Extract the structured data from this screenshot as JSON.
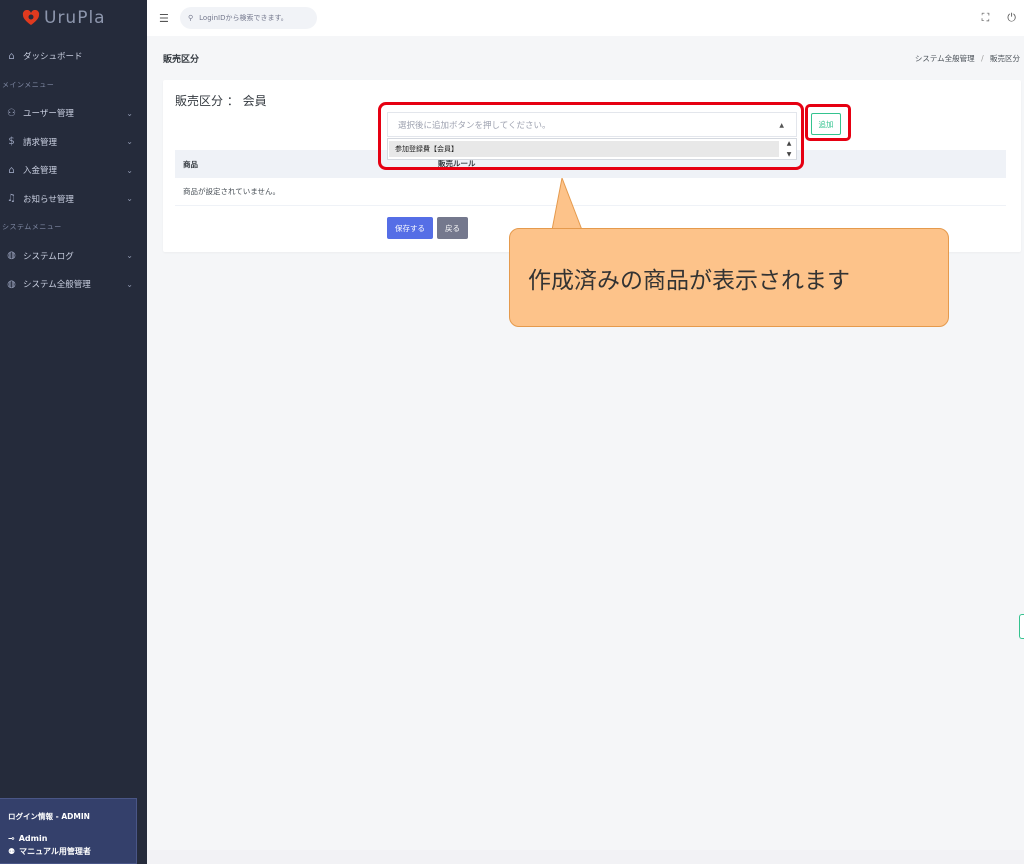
{
  "brand": {
    "name": "UruPla",
    "accent": "#e03a1f"
  },
  "topbar": {
    "search_placeholder": "LoginIDから検索できます。",
    "icons": [
      "menu-icon",
      "search-icon",
      "fullscreen-icon",
      "power-icon"
    ]
  },
  "sidebar": {
    "dashboard": "ダッシュボード",
    "main_menu_title": "メインメニュー",
    "main_items": [
      {
        "label": "ユーザー管理",
        "icon": "user-icon"
      },
      {
        "label": "請求管理",
        "icon": "dollar-icon"
      },
      {
        "label": "入金管理",
        "icon": "bank-icon"
      },
      {
        "label": "お知らせ管理",
        "icon": "bell-icon"
      }
    ],
    "system_menu_title": "システムメニュー",
    "system_items": [
      {
        "label": "システムログ",
        "icon": "globe-icon"
      },
      {
        "label": "システム全般管理",
        "icon": "globe-icon"
      }
    ],
    "login": {
      "title": "ログイン情報 - ADMIN",
      "user": "Admin",
      "role": "マニュアル用管理者"
    }
  },
  "page": {
    "title": "販売区分",
    "breadcrumb": {
      "parent": "システム全般管理",
      "sep": "/",
      "current": "販売区分"
    }
  },
  "card": {
    "title": "販売区分 ： 会員",
    "select_placeholder": "選択後に追加ボタンを押してください。",
    "listbox_option": "参加登録費【会員】",
    "add_button": "追加",
    "table": {
      "headers": [
        "商品",
        "販売ルール"
      ],
      "empty_message": "商品が設定されていません。"
    },
    "save_button": "保存する",
    "back_button": "戻る"
  },
  "annotation": {
    "callout_text": "作成済みの商品が表示されます"
  },
  "colors": {
    "sidebar_bg": "#252b3b",
    "primary": "#556ee6",
    "success": "#34c38f",
    "highlight": "#e60012",
    "callout_bg": "#fdc38a"
  }
}
